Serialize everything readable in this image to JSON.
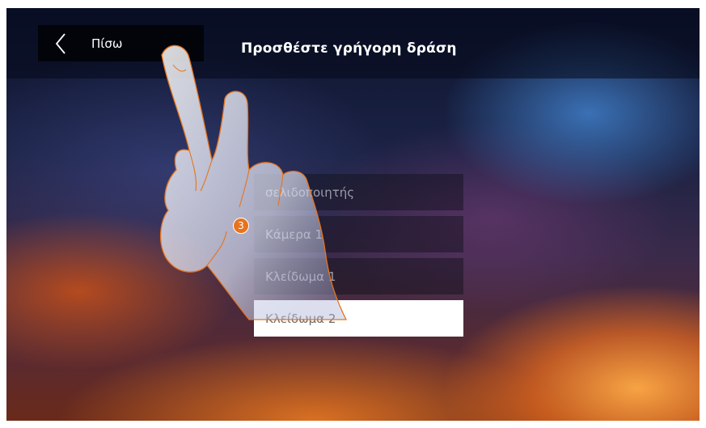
{
  "header": {
    "back_label": "Πίσω",
    "title": "Προσθέστε γρήγορη δράση"
  },
  "list": {
    "items": [
      {
        "label": "σελιδοποιητής"
      },
      {
        "label": "Κάμερα 1"
      },
      {
        "label": "Κλείδωμα 1"
      },
      {
        "label": "Κλείδωμα 2"
      }
    ],
    "selected_index": 3
  },
  "annotation": {
    "step_number": "3",
    "color": "#e8731c"
  }
}
